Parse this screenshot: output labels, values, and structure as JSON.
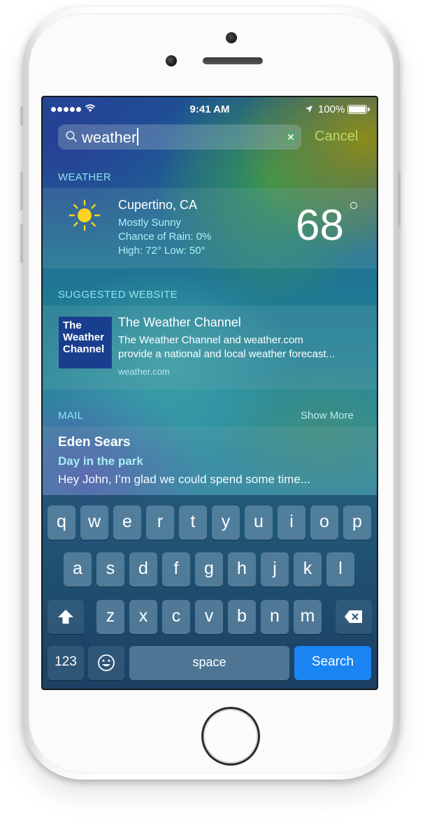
{
  "statusbar": {
    "time": "9:41 AM",
    "battery": "100%"
  },
  "search": {
    "query": "weather",
    "cancel": "Cancel"
  },
  "weather": {
    "heading": "WEATHER",
    "city": "Cupertino, CA",
    "condition": "Mostly Sunny",
    "rain": "Chance of Rain: 0%",
    "highlow": "High: 72°  Low: 50°",
    "temp": "68"
  },
  "website": {
    "heading": "SUGGESTED WEBSITE",
    "logo_lines": [
      "The",
      "Weather",
      "Channel"
    ],
    "title": "The Weather Channel",
    "desc_line1": "The Weather Channel and weather.com",
    "desc_line2": "provide a national and local weather forecast...",
    "url": "weather.com"
  },
  "mail": {
    "heading": "MAIL",
    "show_more": "Show More",
    "from": "Eden Sears",
    "subject": "Day in the park",
    "preview": "Hey John, I’m glad we could spend some time..."
  },
  "keyboard": {
    "row1": [
      "q",
      "w",
      "e",
      "r",
      "t",
      "y",
      "u",
      "i",
      "o",
      "p"
    ],
    "row2": [
      "a",
      "s",
      "d",
      "f",
      "g",
      "h",
      "j",
      "k",
      "l"
    ],
    "row3": [
      "z",
      "x",
      "c",
      "v",
      "b",
      "n",
      "m"
    ],
    "num_label": "123",
    "space_label": "space",
    "search_label": "Search"
  },
  "colors": {
    "accent": "#1a84f3",
    "cancel": "#b9d86a",
    "section_heading": "#8fe3ef"
  },
  "icons": [
    "search-icon",
    "clear-icon",
    "sun-icon",
    "wifi-icon",
    "location-icon",
    "battery-icon",
    "shift-icon",
    "delete-icon",
    "emoji-icon"
  ]
}
